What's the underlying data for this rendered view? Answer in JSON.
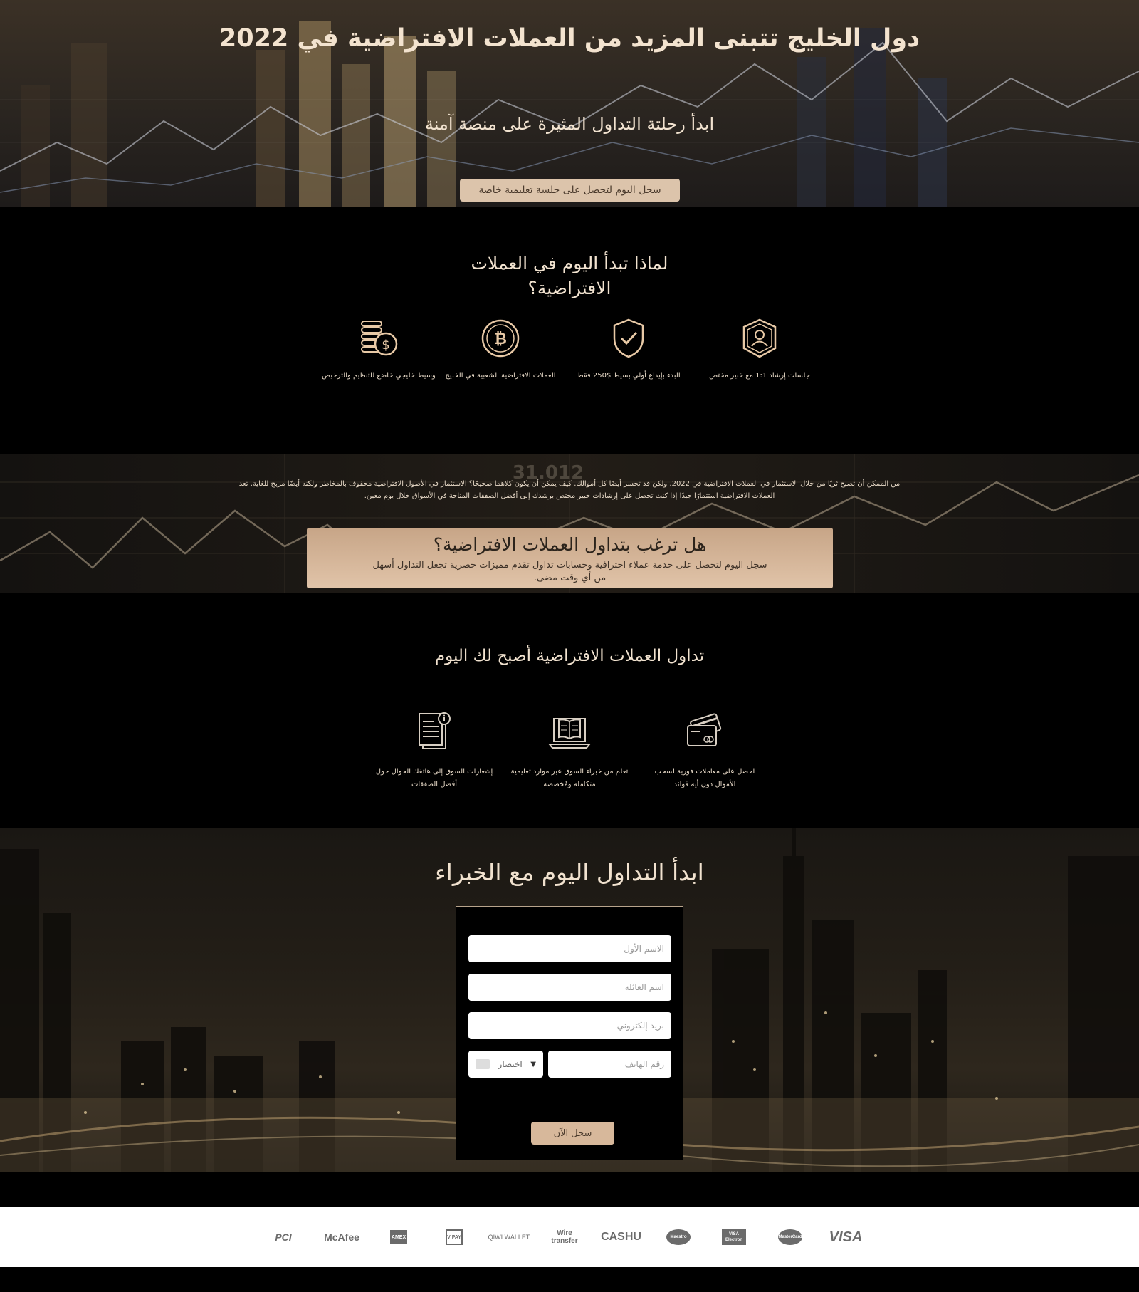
{
  "hero": {
    "title": "دول الخليج تتبنى المزيد من العملات الافتراضية في 2022",
    "subtitle": "ابدأ رحلتة التداول المثيرة على منصة آمنة",
    "cta_label": "سجل اليوم لتحصل على جلسة تعليمية خاصة"
  },
  "why": {
    "title": "لماذا تبدأ اليوم في العملات الافتراضية؟",
    "features": [
      {
        "icon": "expert-shield-icon",
        "label": "جلسات إرشاد 1:1 مع خبير مختص"
      },
      {
        "icon": "check-shield-icon",
        "label": "البدء بإيداع أولي بسيط $250 فقط"
      },
      {
        "icon": "bitcoin-coin-icon",
        "label": "العملات الافتراضية الشعبية في الخليج"
      },
      {
        "icon": "coin-stack-icon",
        "label": "وسيط خليجي خاضع للتنظيم والترخيص"
      }
    ]
  },
  "banner": {
    "paragraph": "من الممكن أن تصبح ثريًا من خلال الاستثمار في العملات الافتراضية في 2022. ولكن قد تخسر أيضًا كل أموالك. كيف يمكن أن يكون كلاهما صحيحًا؟ الاستثمار في الأصول الافتراضية محفوف بالمخاطر ولكنه أيضًا مربح للغاية. تعد العملات الافتراضية استثمارًا جيدًا إذا كنت تحصل على إرشادات خبير مختص يرشدك إلى أفضل الصفقات المتاحة في الأسواق خلال يوم معين.",
    "bg_number": "31.012",
    "cta_title": "هل ترغب بتداول العملات الافتراضية؟",
    "cta_text": "سجل اليوم لتحصل على خدمة عملاء احترافية وحسابات تداول تقدم مميزات حصرية تجعل التداول أسهل من أي وقت مضى."
  },
  "trade": {
    "title": "تداول العملات الافتراضية أصبح لك اليوم",
    "features": [
      {
        "icon": "credit-card-icon",
        "label": "احصل على معاملات فورية لسحب الأموال دون أية فوائد"
      },
      {
        "icon": "laptop-book-icon",
        "label": "تعلم من خبراء السوق عبر موارد تعليمية متكاملة ومُخصصة"
      },
      {
        "icon": "document-info-icon",
        "label": "إشعارات السوق إلى هاتفك الجوال حول أفضل الصفقات"
      }
    ]
  },
  "form": {
    "title": "ابدأ التداول اليوم مع الخبراء",
    "first_name_placeholder": "الاسم الأول",
    "last_name_placeholder": "اسم العائلة",
    "email_placeholder": "بريد إلكتروني",
    "phone_placeholder": "رقم الهاتف",
    "prefix_label": "اختصار",
    "submit_label": "سجل الآن"
  },
  "payments": {
    "items": [
      "PCI",
      "McAfee",
      "AMEX",
      "V PAY",
      "QIWI WALLET",
      "Wire transfer",
      "CASHU",
      "Maestro",
      "VISA Electron",
      "MasterCard",
      "VISA"
    ]
  },
  "colors": {
    "accent": "#dcc4ab",
    "text_gold": "#f1e2cf",
    "background": "#000000"
  }
}
